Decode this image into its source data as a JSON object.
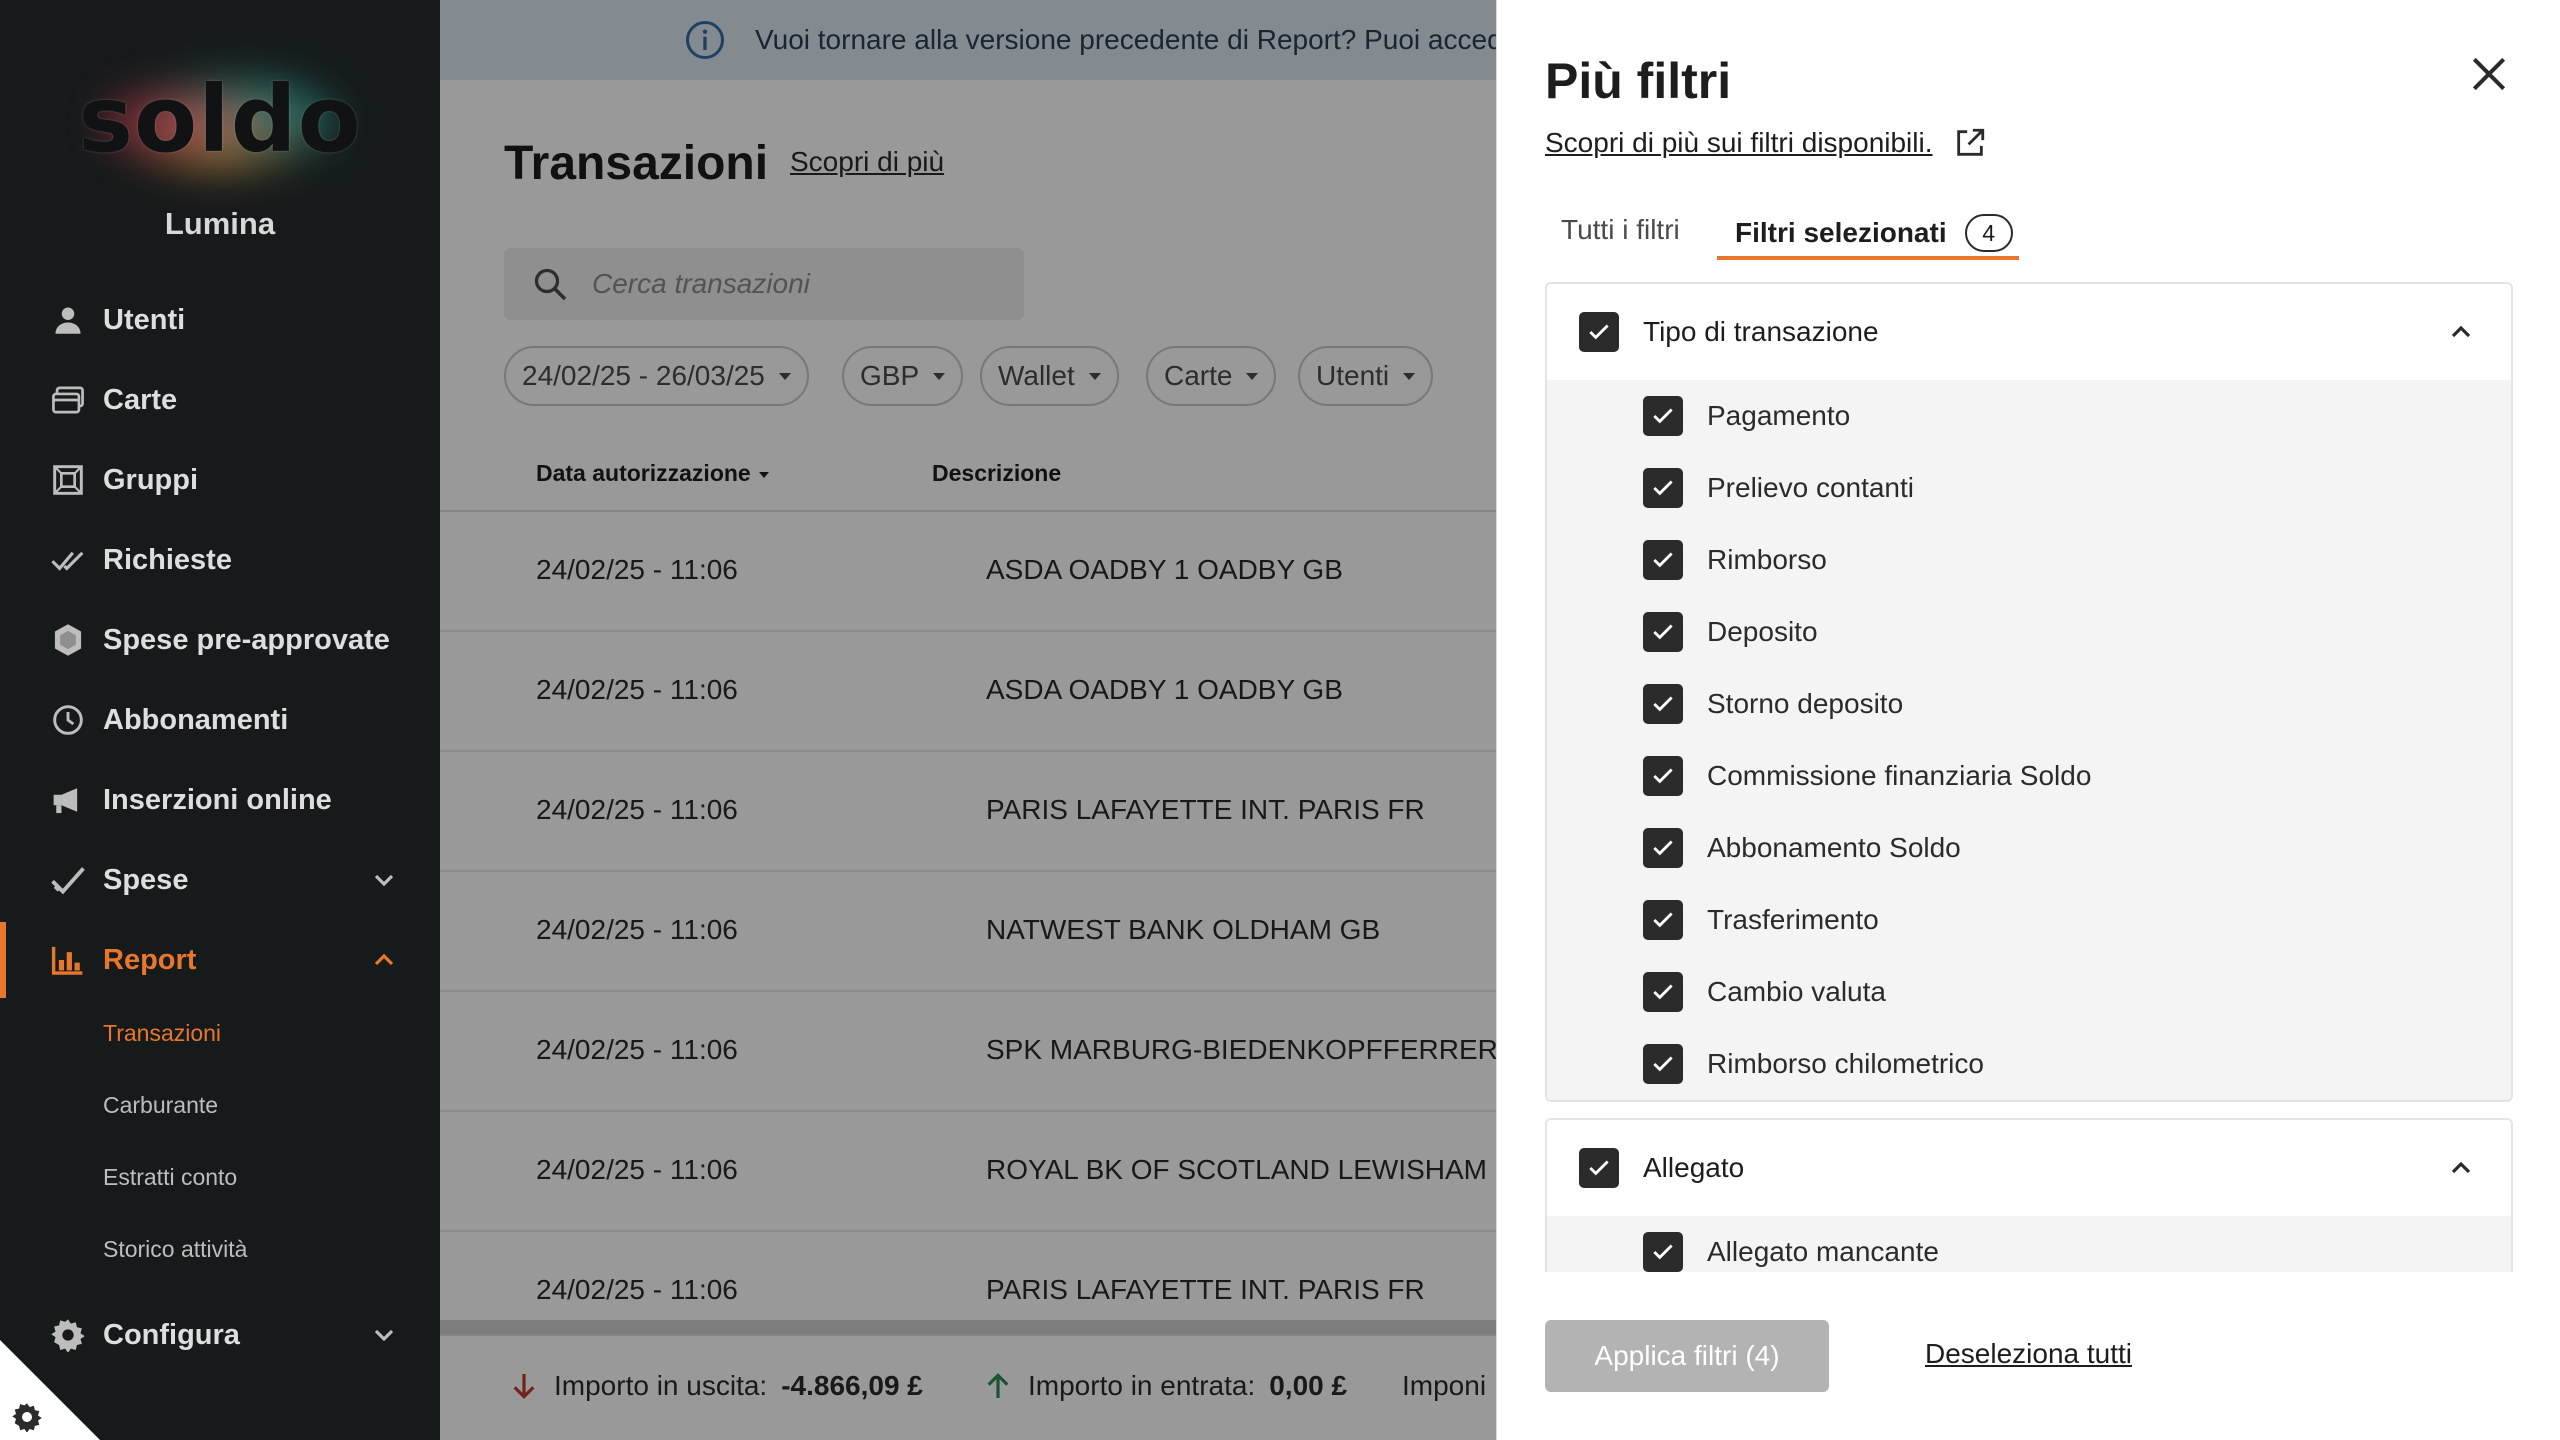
{
  "sidebar": {
    "logo": "soldo",
    "org_name": "Lumina",
    "items": [
      {
        "label": "Utenti",
        "icon": "user-icon"
      },
      {
        "label": "Carte",
        "icon": "cards-icon"
      },
      {
        "label": "Gruppi",
        "icon": "groups-icon"
      },
      {
        "label": "Richieste",
        "icon": "double-check-icon"
      },
      {
        "label": "Spese pre-approvate",
        "icon": "shield-icon"
      },
      {
        "label": "Abbonamenti",
        "icon": "clock-icon"
      },
      {
        "label": "Inserzioni online",
        "icon": "megaphone-icon"
      },
      {
        "label": "Spese",
        "icon": "check-icon"
      },
      {
        "label": "Report",
        "icon": "bar-chart-icon"
      },
      {
        "label": "Configura",
        "icon": "gear-icon"
      }
    ],
    "report_sub": [
      "Transazioni",
      "Carburante",
      "Estratti conto",
      "Storico attività"
    ],
    "active_item": "Report",
    "active_sub": "Transazioni",
    "accent": "#e8772e"
  },
  "main": {
    "banner_text": "Vuoi tornare alla versione precedente di Report? Puoi accede",
    "title": "Transazioni",
    "learn_more": "Scopri di più",
    "search_placeholder": "Cerca transazioni",
    "chips": [
      "24/02/25 - 26/03/25",
      "GBP",
      "Wallet",
      "Carte",
      "Utenti"
    ],
    "columns": [
      "Data autorizzazione",
      "Descrizione"
    ],
    "rows": [
      {
        "date": "24/02/25 - 11:06",
        "description": "ASDA OADBY 1 OADBY GB"
      },
      {
        "date": "24/02/25 - 11:06",
        "description": "ASDA OADBY 1 OADBY GB"
      },
      {
        "date": "24/02/25 - 11:06",
        "description": "PARIS LAFAYETTE INT. PARIS FR"
      },
      {
        "date": "24/02/25 - 11:06",
        "description": "NATWEST BANK OLDHAM GB"
      },
      {
        "date": "24/02/25 - 11:06",
        "description": "SPK MARBURG-BIEDENKOPFFERRERO DE"
      },
      {
        "date": "24/02/25 - 11:06",
        "description": "ROYAL BK OF SCOTLAND LEWISHAM GB"
      },
      {
        "date": "24/02/25 - 11:06",
        "description": "PARIS LAFAYETTE INT. PARIS FR"
      }
    ],
    "footer": {
      "out_label": "Importo in uscita:",
      "out_value": "-4.866,09 £",
      "in_label": "Importo in entrata:",
      "in_value": "0,00 £",
      "taxable_label": "Imponi"
    }
  },
  "panel": {
    "title": "Più filtri",
    "link": "Scopri di più sui filtri disponibili.",
    "tabs": {
      "all": "Tutti i filtri",
      "selected": "Filtri selezionati",
      "selected_count": "4"
    },
    "sections": [
      {
        "title": "Tipo di transazione",
        "options": [
          "Pagamento",
          "Prelievo contanti",
          "Rimborso",
          "Deposito",
          "Storno deposito",
          "Commissione finanziaria Soldo",
          "Abbonamento Soldo",
          "Trasferimento",
          "Cambio valuta",
          "Rimborso chilometrico"
        ]
      },
      {
        "title": "Allegato",
        "options": [
          "Allegato mancante"
        ]
      }
    ],
    "apply_button": "Applica filtri (4)",
    "deselect_all": "Deseleziona tutti"
  }
}
